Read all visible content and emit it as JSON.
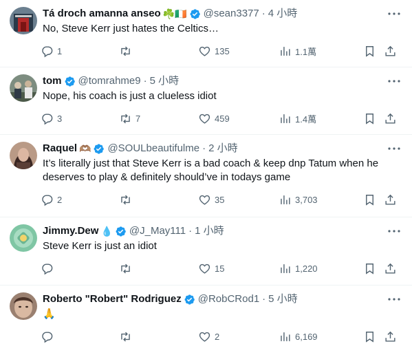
{
  "colors": {
    "text": "#0f1419",
    "secondary": "#536471",
    "verified": "#1d9bf0",
    "divider": "#eff3f4"
  },
  "tweets": [
    {
      "name": "Tá droch amanna anseo",
      "name_emoji": "☘️🇮🇪",
      "verified": true,
      "handle": "@sean3377",
      "time": "4 小時",
      "text": "No, Steve Kerr just hates the Celtics…",
      "replies": "1",
      "retweets": "",
      "likes": "135",
      "views": "1.1萬"
    },
    {
      "name": "tom",
      "name_emoji": "",
      "verified": true,
      "handle": "@tomrahme9",
      "time": "5 小時",
      "text": "Nope, his coach is just a clueless idiot",
      "replies": "3",
      "retweets": "7",
      "likes": "459",
      "views": "1.4萬"
    },
    {
      "name": "Raquel",
      "name_emoji": "🫶🏽",
      "verified": true,
      "handle": "@SOULbeautifulme",
      "time": "2 小時",
      "text": "It’s literally just that Steve Kerr is a bad coach & keep dnp Tatum when he deserves to play & definitely should’ve in todays game",
      "replies": "2",
      "retweets": "",
      "likes": "35",
      "views": "3,703"
    },
    {
      "name": "Jimmy.Dew",
      "name_emoji": "💧",
      "verified": true,
      "handle": "@J_May111",
      "time": "1 小時",
      "text": "Steve Kerr is just an idiot",
      "replies": "",
      "retweets": "",
      "likes": "15",
      "views": "1,220"
    },
    {
      "name": "Roberto \"Robert\" Rodriguez",
      "name_emoji": "",
      "verified": true,
      "handle": "@RobCRod1",
      "time": "5 小時",
      "text": "🙏",
      "replies": "",
      "retweets": "",
      "likes": "2",
      "views": "6,169"
    }
  ]
}
